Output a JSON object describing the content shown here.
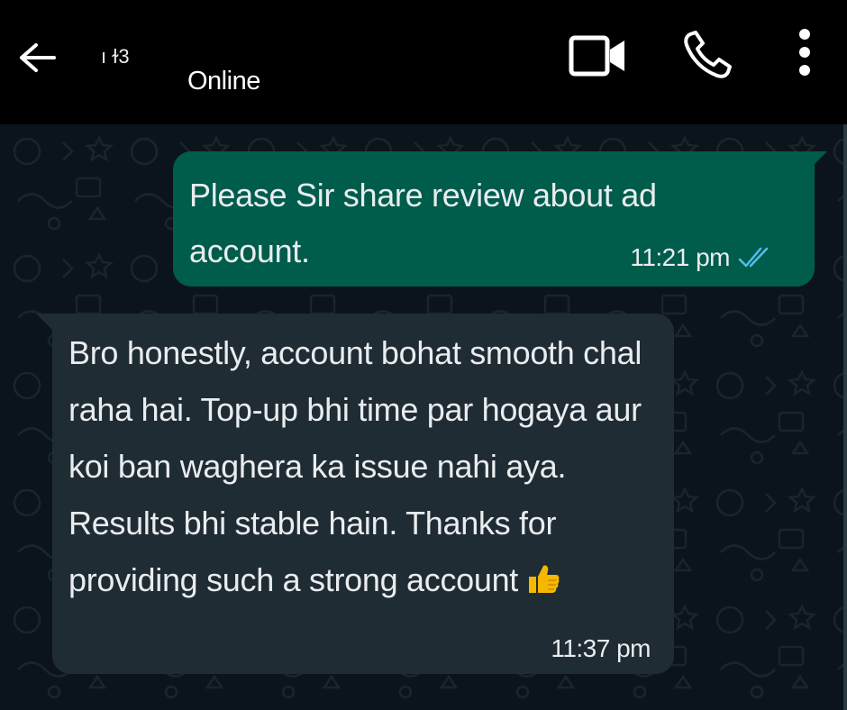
{
  "header": {
    "contact_name": "ı ɫ3",
    "status": "Online",
    "icons": {
      "back": "arrow-left-icon",
      "video": "video-camera-icon",
      "call": "phone-icon",
      "menu": "more-vertical-icon"
    }
  },
  "colors": {
    "header_bg": "#000000",
    "chat_bg": "#0b141a",
    "outgoing_bubble": "#005c4b",
    "incoming_bubble": "#202c33",
    "read_ticks": "#53bdeb",
    "emoji": "#f5b800"
  },
  "messages": [
    {
      "direction": "outgoing",
      "text": " Please Sir share review about ad account.",
      "time": "11:21 pm",
      "status_icon": "double-check-read-icon"
    },
    {
      "direction": "incoming",
      "text": " Bro honestly, account bohat smooth chal raha hai. Top-up bhi time par hogaya aur koi ban waghera ka issue nahi aya. Results bhi stable hain. Thanks for providing such a strong account",
      "emoji_icon": "thumbs-up-icon",
      "time": "11:37 pm"
    }
  ]
}
